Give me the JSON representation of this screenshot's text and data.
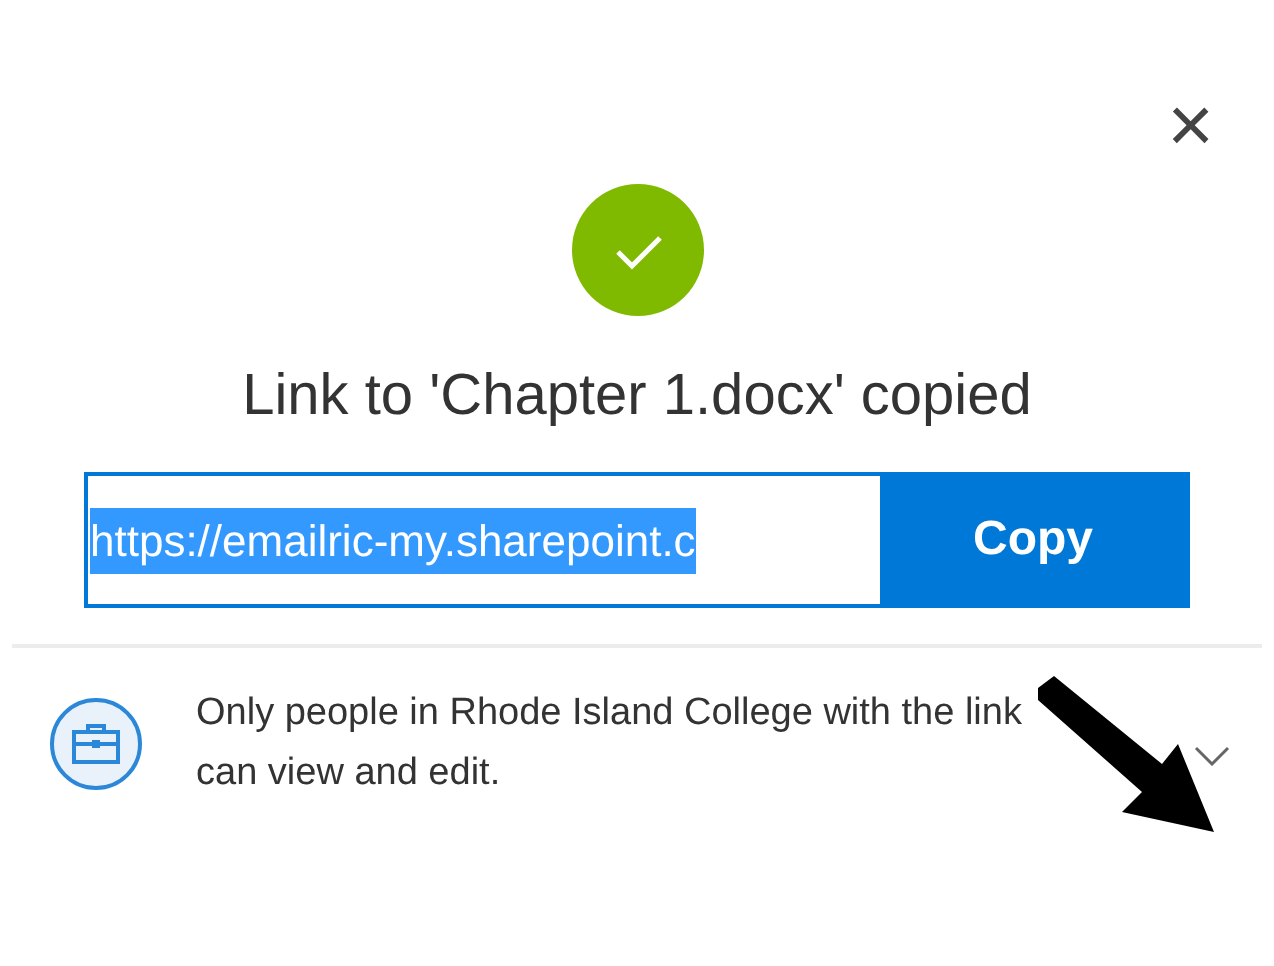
{
  "dialog": {
    "close": "×",
    "title": "Link to 'Chapter 1.docx' copied"
  },
  "link_field": {
    "value": "https://emailric-my.sharepoint.c",
    "selected": true
  },
  "copy_button": {
    "label": "Copy"
  },
  "permission": {
    "text": "Only people in Rhode Island College with the link can view and edit.",
    "expanded": false
  }
}
